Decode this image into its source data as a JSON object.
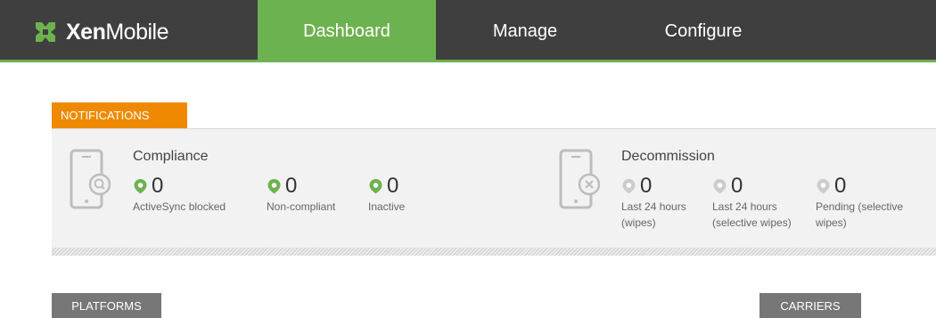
{
  "brand": {
    "name_bold": "Xen",
    "name_light": "Mobile"
  },
  "nav": {
    "dashboard": "Dashboard",
    "manage": "Manage",
    "configure": "Configure"
  },
  "notifications": {
    "tab_label": "NOTIFICATIONS",
    "compliance": {
      "title": "Compliance",
      "icon": "phone-search-icon",
      "metrics": [
        {
          "value": "0",
          "label": "ActiveSync blocked",
          "status": "green"
        },
        {
          "value": "0",
          "label": "Non-compliant",
          "status": "green"
        },
        {
          "value": "0",
          "label": "Inactive",
          "status": "green"
        }
      ]
    },
    "decommission": {
      "title": "Decommission",
      "icon": "phone-wipe-icon",
      "metrics": [
        {
          "value": "0",
          "label_line1": "Last 24 hours",
          "label_line2": "(wipes)",
          "status": "gray"
        },
        {
          "value": "0",
          "label_line1": "Last 24 hours",
          "label_line2": "(selective wipes)",
          "status": "gray"
        },
        {
          "value": "0",
          "label_line1": "Pending (selective",
          "label_line2": "wipes)",
          "status": "gray"
        }
      ]
    }
  },
  "sections": {
    "platforms": "PLATFORMS",
    "carriers": "CARRIERS"
  },
  "colors": {
    "topbar": "#3f3f3f",
    "accent_green": "#6db250",
    "notification_orange": "#ef8a00",
    "section_gray": "#777777",
    "pin_gray": "#cccccc"
  }
}
